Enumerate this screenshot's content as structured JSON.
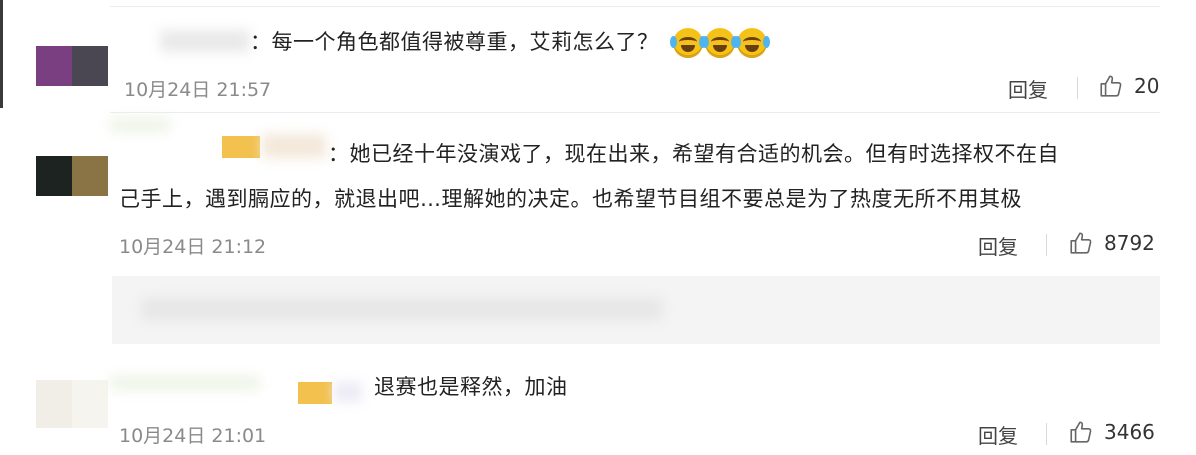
{
  "comments": [
    {
      "text": "：每一个角色都值得被尊重，艾莉怎么了？",
      "emojis": [
        "laugh-cry-emoji",
        "laugh-cry-emoji",
        "laugh-cry-emoji"
      ],
      "time": "10月24日 21:57",
      "reply_label": "回复",
      "likes": "20",
      "avatar_colors": [
        "#7a3f80",
        "#4a4753"
      ]
    },
    {
      "text_line1": "：她已经十年没演戏了，现在出来，希望有合适的机会。但有时选择权不在自",
      "text_line2": "己手上，遇到膈应的，就退出吧…理解她的决定。也希望节目组不要总是为了热度无所不用其极",
      "time": "10月24日 21:12",
      "reply_label": "回复",
      "likes": "8792",
      "avatar_colors": [
        "#1d2320",
        "#8a7445"
      ]
    },
    {
      "text": "退赛也是释然，加油",
      "time": "10月24日 21:01",
      "reply_label": "回复",
      "likes": "3466",
      "avatar_colors": [
        "#f0eee6",
        "#f6f4ee"
      ]
    }
  ]
}
